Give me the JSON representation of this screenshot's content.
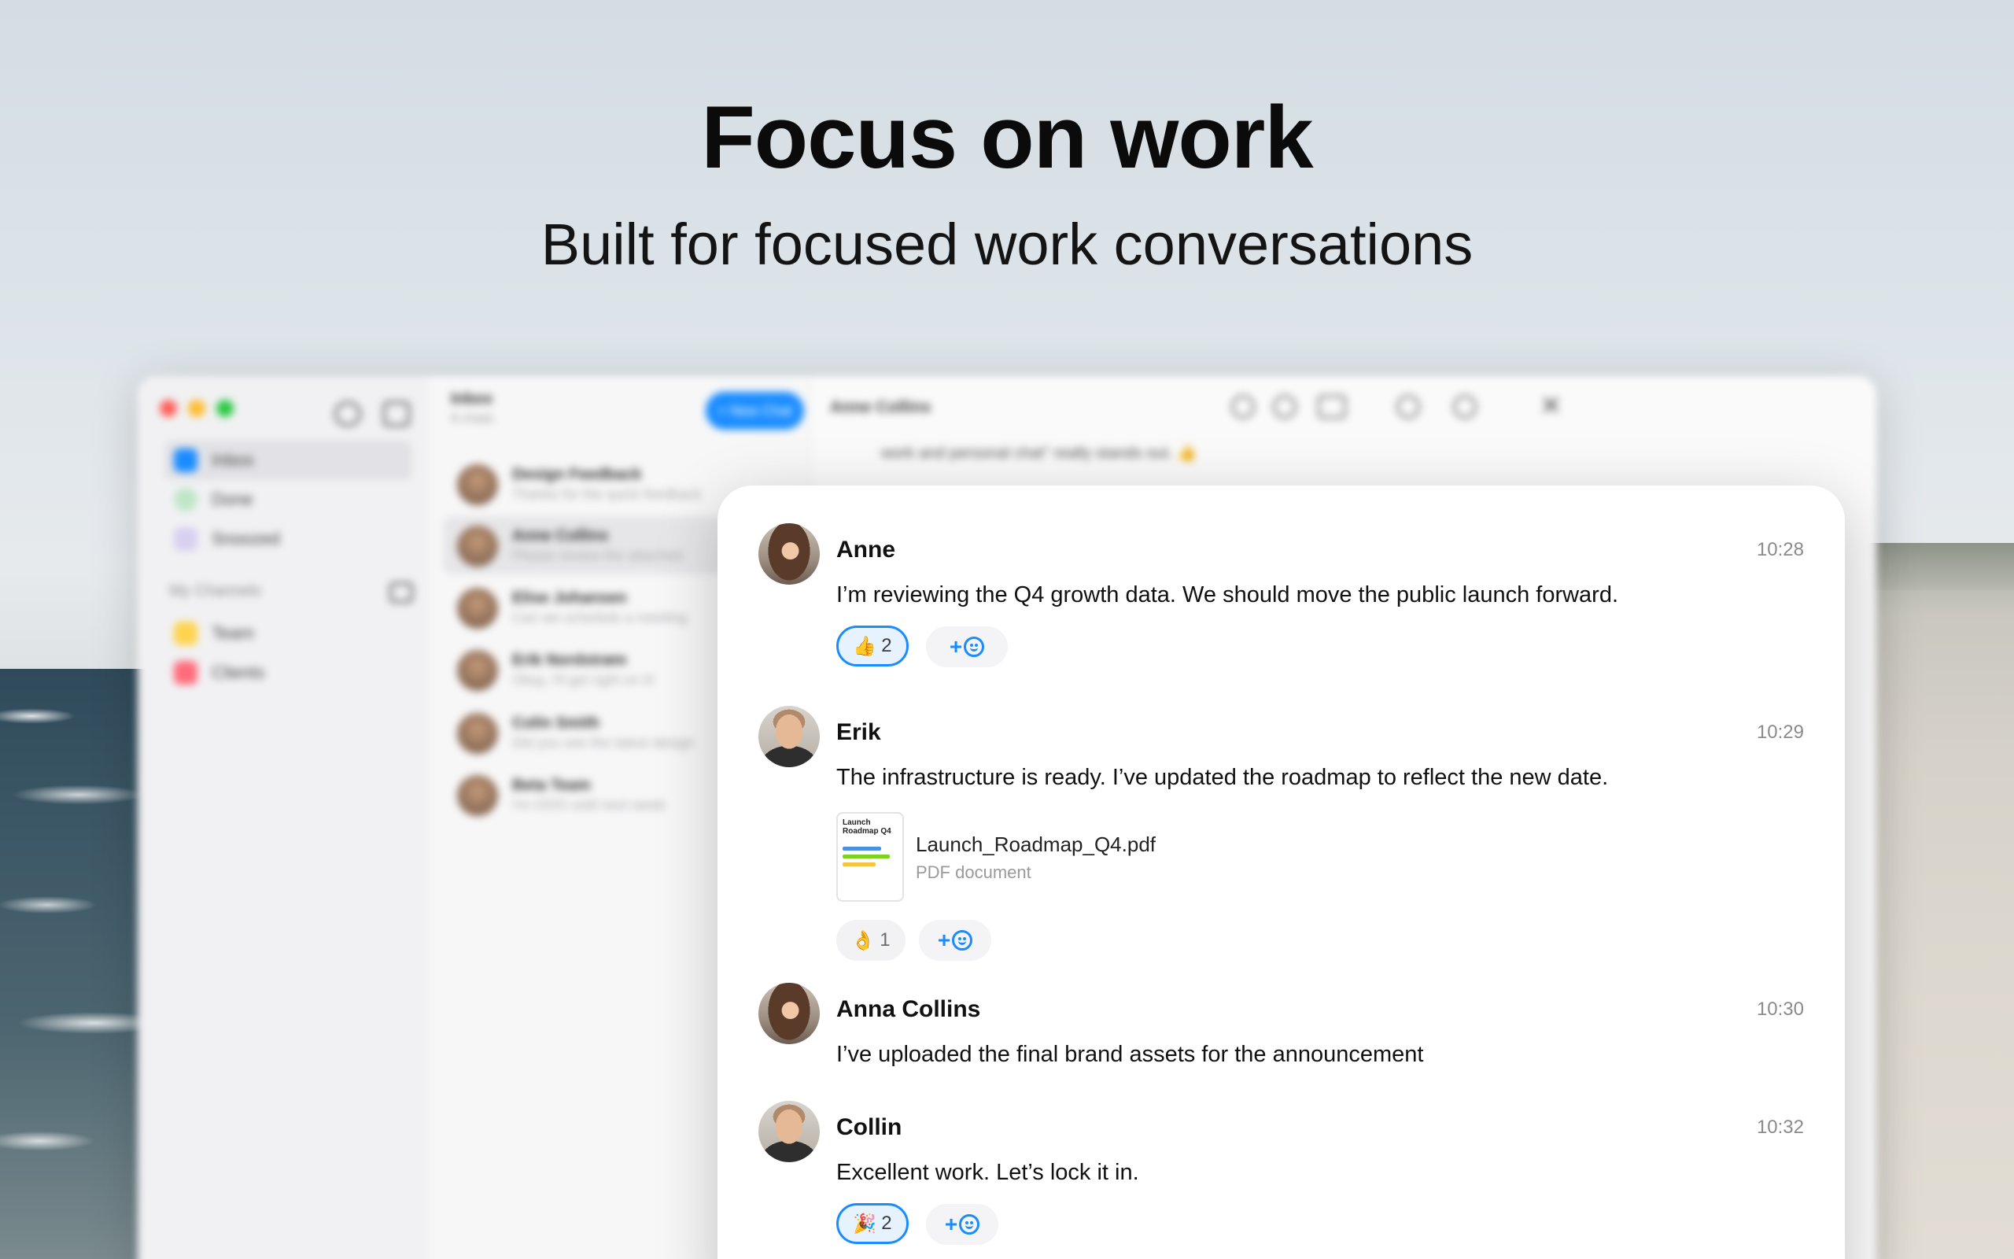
{
  "headline": "Focus on work",
  "subheadline": "Built for focused work conversations",
  "background_app": {
    "sidebar": {
      "items": [
        "Inbox",
        "Done",
        "Snoozed"
      ],
      "section_title": "My Channels",
      "channels": [
        "Team",
        "Clients"
      ]
    },
    "chat_list": {
      "title": "Inbox",
      "subtitle": "6 chats",
      "new_chat_label": "+ New Chat",
      "chats": [
        {
          "name": "Design Feedback",
          "preview": "Thanks for the quick feedback"
        },
        {
          "name": "Anne Collins",
          "preview": "Please review the attached"
        },
        {
          "name": "Elise Johansen",
          "preview": "Can we schedule a meeting"
        },
        {
          "name": "Erik Nordstrøm",
          "preview": "Okay, I'll get right on it!"
        },
        {
          "name": "Colin Smith",
          "preview": "Did you see the latest design"
        },
        {
          "name": "Beta Team",
          "preview": "I'm OOO until next week"
        }
      ]
    },
    "conversation_title": "Anne Collins",
    "conversation_snippet": "work and personal chat\" really stands out. 👍"
  },
  "messages": [
    {
      "sender": "Anne",
      "time": "10:28",
      "text": "I’m reviewing the Q4 growth data. We should move the public launch forward.",
      "reaction": {
        "emoji": "👍",
        "count": "2",
        "active": true
      }
    },
    {
      "sender": "Erik",
      "time": "10:29",
      "text": "The infrastructure is ready. I’ve updated the roadmap to reflect the new date.",
      "attachment": {
        "thumb_title": "Launch Roadmap Q4",
        "name": "Launch_Roadmap_Q4.pdf",
        "type": "PDF document"
      },
      "reaction": {
        "emoji": "👌",
        "count": "1",
        "active": false
      }
    },
    {
      "sender": "Anna Collins",
      "time": "10:30",
      "text": "I’ve uploaded the final brand assets for the announcement"
    },
    {
      "sender": "Collin",
      "time": "10:32",
      "text": "Excellent work. Let’s lock it in.",
      "reaction": {
        "emoji": "🎉",
        "count": "2",
        "active": true
      }
    }
  ],
  "add_reaction_label": "+",
  "colors": {
    "accent": "#1a8cff",
    "active_reaction_bg": "#e6f3ff"
  }
}
